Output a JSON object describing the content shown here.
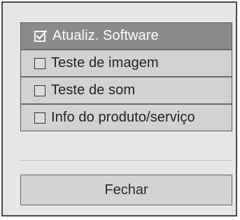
{
  "menu": {
    "items": [
      {
        "label": "Atualiz. Software",
        "checked": true,
        "icon": "checked-box-icon"
      },
      {
        "label": "Teste de imagem",
        "checked": false,
        "icon": "checkbox-icon"
      },
      {
        "label": "Teste de som",
        "checked": false,
        "icon": "checkbox-icon"
      },
      {
        "label": "Info do produto/serviço",
        "checked": false,
        "icon": "checkbox-icon"
      }
    ]
  },
  "close_button": {
    "label": "Fechar"
  },
  "colors": {
    "selected_background": "#8b8b8b",
    "item_background": "#d2d2d2",
    "dialog_background": "#e6e6e6"
  }
}
